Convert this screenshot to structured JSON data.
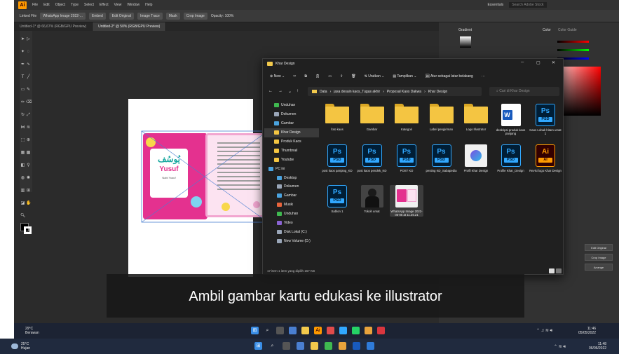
{
  "illustrator": {
    "menu": [
      "File",
      "Edit",
      "Object",
      "Type",
      "Select",
      "Effect",
      "View",
      "Window",
      "Help"
    ],
    "workspace": "Essentials",
    "search_placeholder": "Search Adobe Stock",
    "control_bar": [
      "Linked File",
      "WhatsApp Image 2022-...",
      "Embed",
      "Edit Original",
      "Image Trace",
      "Mask",
      "Crop Image",
      "Opacity: 100%"
    ],
    "doc_tabs": [
      "Untitled-1* @ 66,67% (RGB/GPU Preview)",
      "Untitled-2* @ 50% (RGB/GPU Preview)"
    ],
    "card_front": {
      "name": "Yusuf",
      "arabic": "يُوسُف",
      "caption": "Nabi Yusuf"
    },
    "panels": {
      "gradient": "Gradient",
      "color": "Color",
      "color_guide": "Color Guide"
    },
    "panel_buttons": [
      "Edit Original",
      "Crop Image",
      "Arrange"
    ]
  },
  "explorer": {
    "title": "Khar Design",
    "commands": {
      "new": "New",
      "sort": "Urutkan",
      "view": "Tampilkan",
      "extract": "Atur sebagai latar belakang"
    },
    "breadcrumb": [
      "Data",
      "jasa desain kaos_Tugas akhir",
      "Proposal Kaos Dakwa",
      "Khar Design"
    ],
    "search_placeholder": "Cari di Khar Design",
    "nav": [
      {
        "label": "Unduhan",
        "color": "#3fb950"
      },
      {
        "label": "Dokumen",
        "color": "#9aa6b8"
      },
      {
        "label": "Gambar",
        "color": "#4aa3df"
      },
      {
        "label": "Khar Design",
        "color": "#f4c542"
      },
      {
        "label": "Produk Kaos",
        "color": "#f4c542"
      },
      {
        "label": "Thumbnail",
        "color": "#f4c542"
      },
      {
        "label": "Youtube",
        "color": "#f4c542"
      },
      {
        "label": "PC ini",
        "color": "#4aa3df"
      },
      {
        "label": "Desktop",
        "color": "#4aa3df"
      },
      {
        "label": "Dokumen",
        "color": "#9aa6b8"
      },
      {
        "label": "Gambar",
        "color": "#4aa3df"
      },
      {
        "label": "Musik",
        "color": "#e8643c"
      },
      {
        "label": "Unduhan",
        "color": "#3fb950"
      },
      {
        "label": "Video",
        "color": "#8a63d2"
      },
      {
        "label": "Disk Lokal (C:)",
        "color": "#9aa6b8"
      },
      {
        "label": "New Volume (D:)",
        "color": "#9aa6b8"
      }
    ],
    "files": [
      {
        "label": "foto kaos",
        "kind": "folder"
      },
      {
        "label": "Gambar",
        "kind": "folder"
      },
      {
        "label": "Kategori",
        "kind": "folder"
      },
      {
        "label": "Label pengiriman",
        "kind": "folder"
      },
      {
        "label": "Logo Illustrator",
        "kind": "folder"
      },
      {
        "label": "deskripsi produk kaos panjang",
        "kind": "word"
      },
      {
        "label": "Kaos Lobak hitam umat 1",
        "kind": "psd"
      },
      {
        "label": "post kaos panjang_KD",
        "kind": "psd"
      },
      {
        "label": "post kaos pendek_KD",
        "kind": "psd"
      },
      {
        "label": "POST KD",
        "kind": "psd"
      },
      {
        "label": "pesting KD_Sabapedia",
        "kind": "psd"
      },
      {
        "label": "Profil Khar Design",
        "kind": "image"
      },
      {
        "label": "Profile Khar_Design",
        "kind": "psd"
      },
      {
        "label": "Revisi logo Khar Design",
        "kind": "ai"
      },
      {
        "label": "Sablon 1",
        "kind": "psd"
      },
      {
        "label": "Tokoh umat",
        "kind": "photo"
      },
      {
        "label": "WhatsApp Image 2022-05-05 at 11.25.21",
        "kind": "card"
      }
    ],
    "status": "17 item   1 item yang dipilih  157 KB"
  },
  "subtitle": "Ambil gambar kartu edukasi ke illustrator",
  "taskbar_inner": {
    "temp": "29°C",
    "condition": "Berawan",
    "time": "11:46",
    "date": "05/05/2022"
  },
  "taskbar_outer": {
    "temp": "25°C",
    "condition": "Hujan",
    "time": "11:48",
    "date": "06/06/2022"
  }
}
